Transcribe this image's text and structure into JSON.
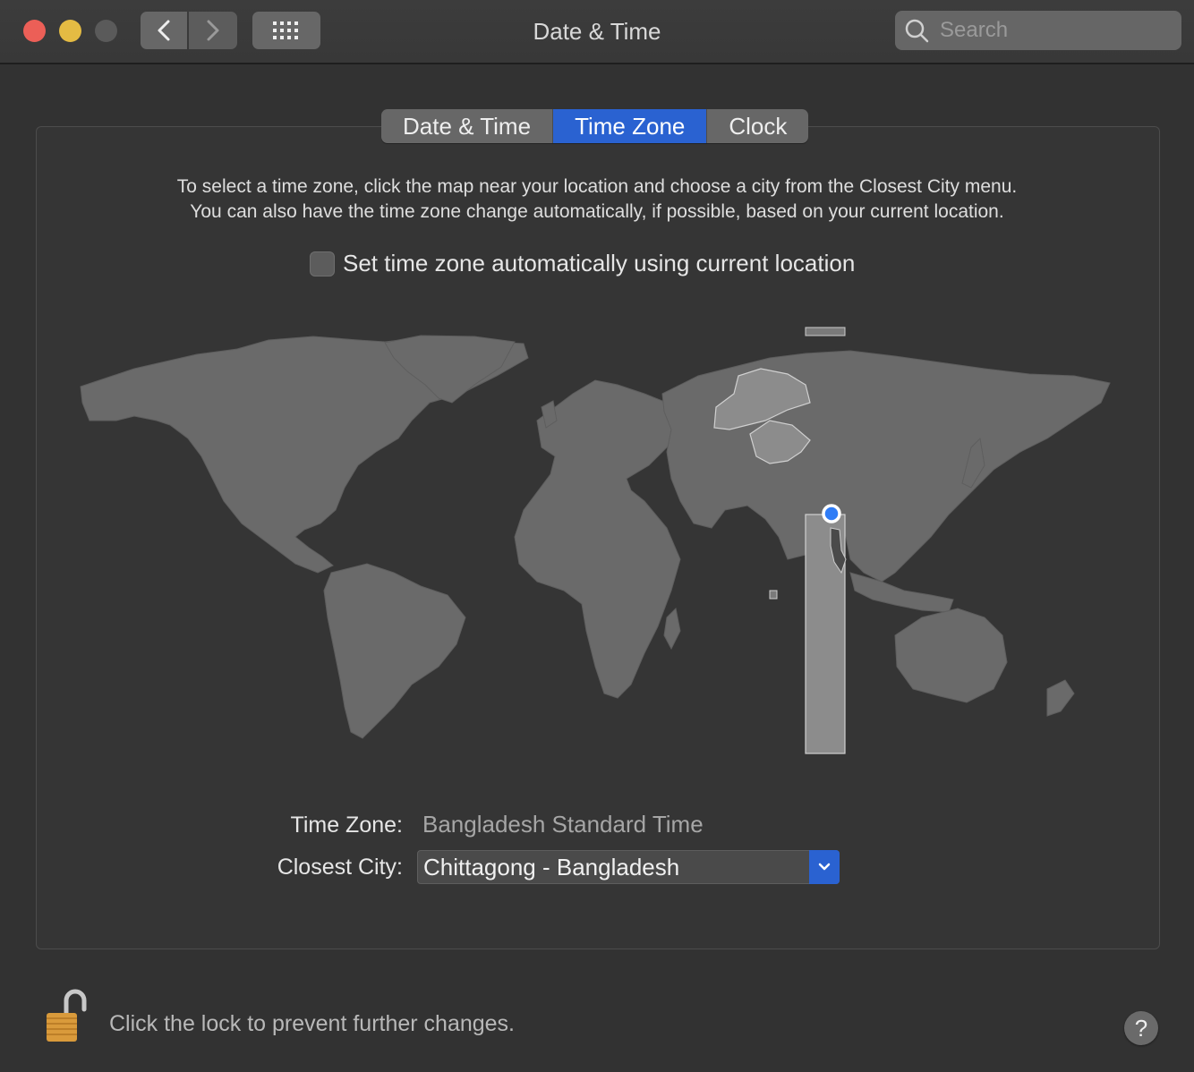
{
  "window": {
    "title": "Date & Time",
    "search_placeholder": "Search"
  },
  "tabs": [
    {
      "label": "Date & Time",
      "active": false
    },
    {
      "label": "Time Zone",
      "active": true
    },
    {
      "label": "Clock",
      "active": false
    }
  ],
  "instructions": {
    "line1": "To select a time zone, click the map near your location and choose a city from the Closest City menu.",
    "line2": "You can also have the time zone change automatically, if possible, based on your current location."
  },
  "auto_timezone": {
    "label": "Set time zone automatically using current location",
    "checked": false
  },
  "fields": {
    "time_zone_label": "Time Zone:",
    "time_zone_value": "Bangladesh Standard Time",
    "closest_city_label": "Closest City:",
    "closest_city_value": "Chittagong - Bangladesh"
  },
  "footer": {
    "lock_text": "Click the lock to prevent further changes.",
    "help_label": "?"
  },
  "colors": {
    "accent": "#2a62d1",
    "land": "#6a6a6a",
    "highlight_zone": "#8c8c8c",
    "location_pin": "#2f7cf6"
  },
  "icons": {
    "back": "chevron-left-icon",
    "forward": "chevron-right-icon",
    "grid": "grid-icon",
    "search": "search-icon",
    "lock": "open-lock-icon",
    "dropdown": "chevron-down-icon"
  }
}
